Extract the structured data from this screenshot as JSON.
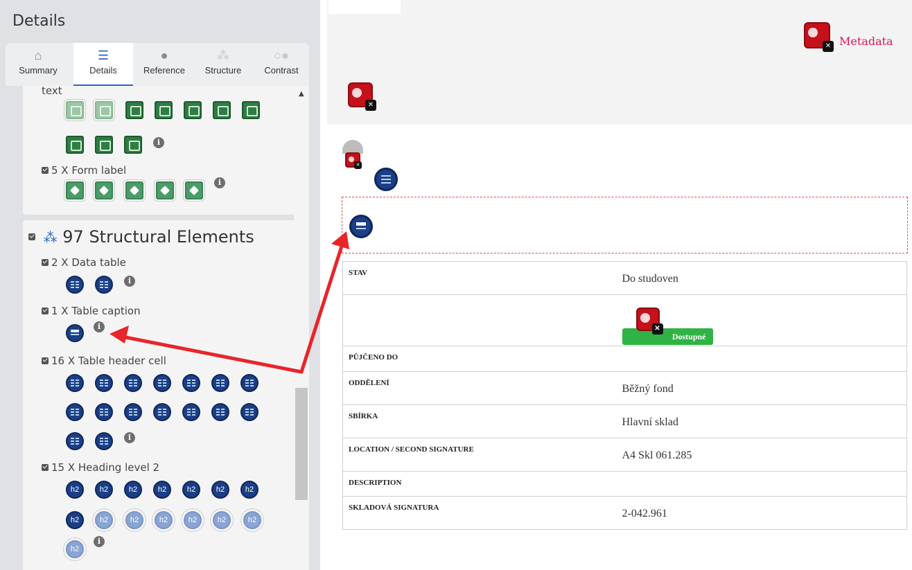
{
  "panel": {
    "title": "Details",
    "tabs": [
      {
        "label": "Summary",
        "icon": "home-icon"
      },
      {
        "label": "Details",
        "icon": "list-icon"
      },
      {
        "label": "Reference",
        "icon": "info-icon"
      },
      {
        "label": "Structure",
        "icon": "hierarchy-icon"
      },
      {
        "label": "Contrast",
        "icon": "contrast-icon"
      }
    ],
    "text_fragment": "text",
    "form_label": "5 X Form label",
    "structural_heading": "97 Structural Elements",
    "data_table": "2 X Data table",
    "table_caption": "1 X Table caption",
    "table_header_cell": "16 X Table header cell",
    "heading_level_2": "15 X Heading level 2"
  },
  "page": {
    "metadata_link": "Metadata",
    "table": {
      "rows": [
        {
          "header": "STAV",
          "value": "Do studoven"
        },
        {
          "header": "",
          "value": "",
          "badge": "Dostupné"
        },
        {
          "header": "PŮJČENO DO",
          "value": ""
        },
        {
          "header": "ODDĚLENÍ",
          "value": "Běžný fond"
        },
        {
          "header": "SBÍRKA",
          "value": "Hlavní sklad"
        },
        {
          "header": "LOCATION / SECOND SIGNATURE",
          "value": "A4 Skl 061.285"
        },
        {
          "header": "DESCRIPTION",
          "value": ""
        },
        {
          "header": "SKLADOVÁ SIGNATURA",
          "value": "2-042.961"
        }
      ]
    }
  },
  "colors": {
    "annotation_arrow": "#e8252a",
    "wave_error_red": "#c4111b",
    "structure_blue": "#1b3f86",
    "available_green": "#2fb344",
    "metadata_link": "#d8155d"
  }
}
